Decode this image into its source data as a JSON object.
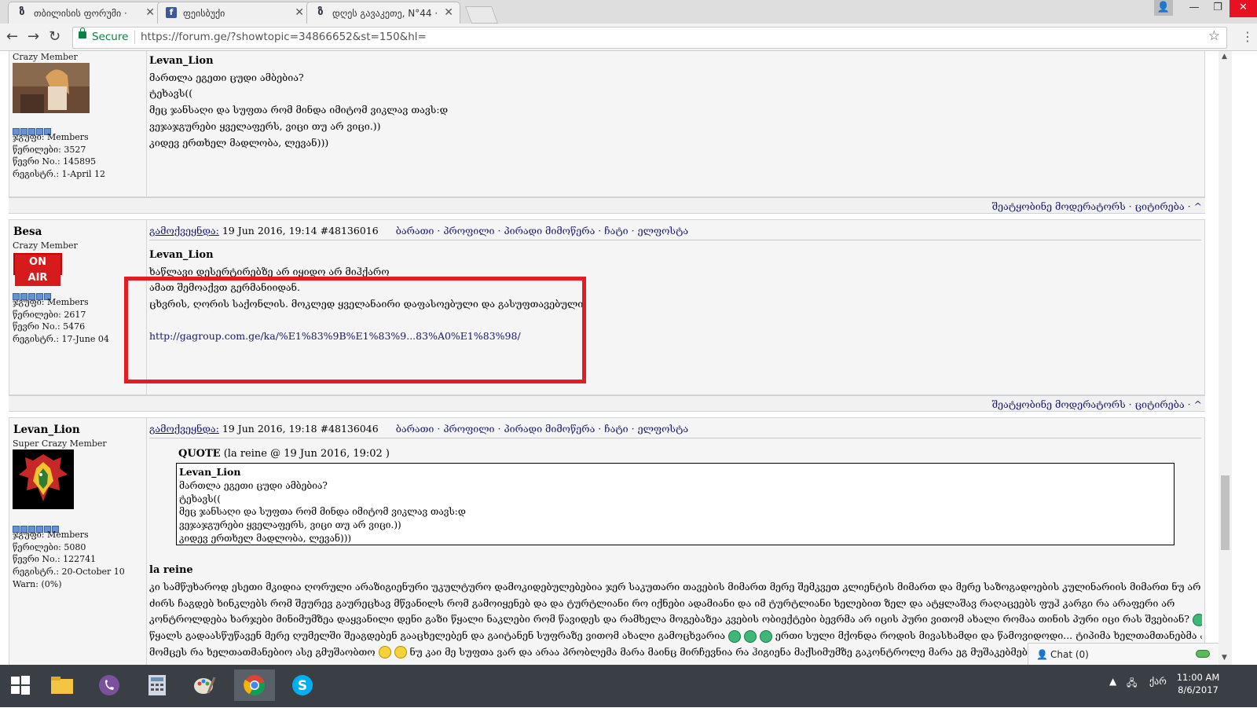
{
  "browser": {
    "tabs": [
      {
        "title": "თბილისის ფორუმი ·",
        "icon": "forum-ge-icon",
        "active": false
      },
      {
        "title": "ფეისბუქი",
        "icon": "facebook-icon",
        "active": false
      },
      {
        "title": "დღეს გავაკეთე, N°44 ·",
        "icon": "forum-ge-icon",
        "active": true
      }
    ],
    "secure_label": "Secure",
    "url": "https://forum.ge/?showtopic=34866652&st=150&hl="
  },
  "posts": [
    {
      "user": {
        "title": "Crazy Member",
        "pips": 5,
        "group": "ჯგუფი: Members",
        "posts_count": "წერილები: 3527",
        "member_no": "წევრი No.: 145895",
        "registered": "რეგისტრ.: 1-April 12"
      },
      "body": {
        "author": "Levan_Lion",
        "lines": [
          "მართლა ეგეთი ცუდი ამბებია?",
          "ტეხავს((",
          "მეც ჯანსაღი და სუფთა რომ მინდა იმიტომ ვიკლავ თავს:დ",
          "ვეჯაჯგურები ყველაფერს, ვიცი თუ არ ვიცი.))",
          "კიდევ ერთხელ მადლობა, ლევან)))"
        ]
      },
      "footer": "შეატყობინე მოდერატორს · ციტირება · ^"
    },
    {
      "user": {
        "name": "Besa",
        "title": "Crazy Member",
        "badge": "ON AIR",
        "pips": 5,
        "group": "ჯგუფი: Members",
        "posts_count": "წერილები: 2617",
        "member_no": "წევრი No.: 5476",
        "registered": "რეგისტრ.: 17-June 04"
      },
      "header": {
        "posted": "გამოქვეყნდა:",
        "date": "19 Jun 2016, 19:14",
        "post_id": "#48136016",
        "actions": "ბარათი · პროფილი · პირადი მიმოწერა · ჩატი · ელფოსტა"
      },
      "body": {
        "author": "Levan_Lion",
        "lines": [
          "ხაწლავი დესერტირებზე არ იყიდო არ მიჰქარო",
          "ამათ შემოაქვთ გერმანიიდან.",
          "ცხვრის, ღორის საქონლის. მოკლედ ყველანაირი დაფასოებული და გასუფთავებული"
        ],
        "link": "http://gagroup.com.ge/ka/%E1%83%9B%E1%83%9...83%A0%E1%83%98/"
      },
      "footer": "შეატყობინე მოდერატორს · ციტირება · ^"
    },
    {
      "user": {
        "name": "Levan_Lion",
        "title": "Super Crazy Member",
        "pips": 6,
        "group": "ჯგუფი: Members",
        "posts_count": "წერილები: 5080",
        "member_no": "წევრი No.: 122741",
        "registered": "რეგისტრ.: 20-October 10",
        "warn": "Warn: (0%)"
      },
      "header": {
        "posted": "გამოქვეყნდა:",
        "date": "19 Jun 2016, 19:18",
        "post_id": "#48136046",
        "actions": "ბარათი · პროფილი · პირადი მიმოწერა · ჩატი · ელფოსტა"
      },
      "quote": {
        "label": "QUOTE",
        "source": "(la reine @ 19 Jun 2016, 19:02 )",
        "author": "Levan_Lion",
        "lines": [
          "მართლა ეგეთი ცუდი ამბებია?",
          "ტეხავს((",
          "მეც ჯანსაღი და სუფთა რომ მინდა იმიტომ ვიკლავ თავს:დ",
          "ვეჯაჯგურები ყველაფერს, ვიცი თუ არ ვიცი.))",
          "კიდევ ერთხელ მადლობა, ლევან)))"
        ]
      },
      "reply": {
        "author": "la reine",
        "line1": "კი სამწუხაროდ ესეთი მკიდია ღორული არაზიგიენური უკულტურო დამოკიდებულებებია ჯერ საკუთარი თავების მიმართ მერე შემკვეთ კლიენტის მიმართ და მერე საზოგადოების კულინარიის მიმართ ნუ არ ვიცი",
        "line2": "ძირს ჩაგდებ ხინკლებს რომ შეურევ გაურეცხავ მწვანილს რომ გამოიყენებ და და ტურტლიანი რო იქნები ადამიანი და იმ ტურტლიანი ხელებით ზელ და ატყლაშავ რაღაცეებს ფუჰ კარგი რა არაფერი არ",
        "line3": "კონტროლდება ხარჯები მინიმუმზეა დაყვანილი დენი გაზი წყალი ნაკლები რომ წავიდეს და რამხელა მოგებაზეა კვების ობიექტები ბევრმა არ იცის პური ვითომ ახალი რომაა თინის პური იცი რას შვებიან?",
        "line4": "წყალს გადაასწუწავენ მერე ღუმელში შეაგდებენ გააცხელებენ და გაიტანენ სუფრაზე ვითომ ახალი გამოცხვარია",
        "line4b": "ერთი სული მქონდა როდის მივასხამდი და წამოვიდოდი... ტიპიმა ხელთამთანებმა არ",
        "line5": "მომცეს რა ხელთათმანებიო ასე გმუშაობთო",
        "line5b": "ნუ კაი მე სუფთა ვარ და არაა პრობლემა მარა მაინც მირჩევნია რა ჰიგიენა მაქსიმუმზე გაკონტროლე მარა ეგ მუშაკებმებია რო"
      },
      "chat": "Chat (0)"
    }
  ],
  "taskbar": {
    "time": "11:00 AM",
    "date": "8/6/2017",
    "lang": "ქარ"
  }
}
